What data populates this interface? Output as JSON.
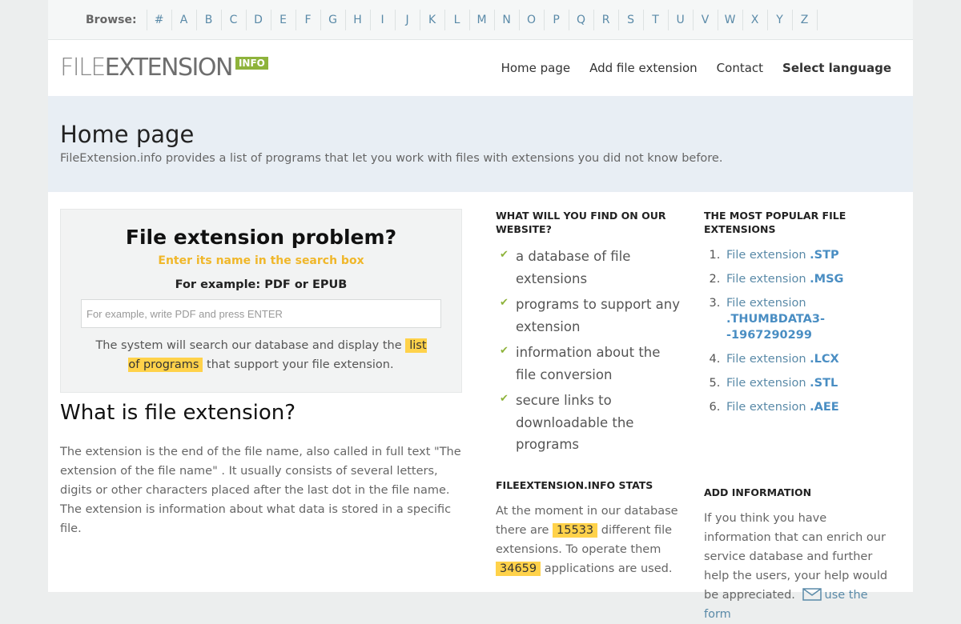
{
  "browse": {
    "label": "Browse:",
    "letters": [
      "#",
      "A",
      "B",
      "C",
      "D",
      "E",
      "F",
      "G",
      "H",
      "I",
      "J",
      "K",
      "L",
      "M",
      "N",
      "O",
      "P",
      "Q",
      "R",
      "S",
      "T",
      "U",
      "V",
      "W",
      "X",
      "Y",
      "Z"
    ]
  },
  "logo": {
    "part1": "FILE",
    "part2": "EXTENSION",
    "tag": "INFO"
  },
  "nav": {
    "home": "Home page",
    "add": "Add file extension",
    "contact": "Contact",
    "language": "Select language"
  },
  "hero": {
    "title": "Home page",
    "subtitle": "FileExtension.info provides a list of programs that let you work with files with extensions you did not know before."
  },
  "search": {
    "title": "File extension problem?",
    "subtitle": "Enter its name in the search box",
    "example": "For example: PDF or EPUB",
    "placeholder": "For example, write PDF and press ENTER",
    "desc_before": "The system will search our database and display the ",
    "desc_highlight": "list of programs",
    "desc_after": " that support your file extension."
  },
  "what": {
    "title": "What is file extension?",
    "text": "The extension is the end of the file name, also called in full text \"The extension of the file name\" . It usually consists of several letters, digits or other characters placed after the last dot in the file name. The extension is information about what data is stored in a specific file."
  },
  "find": {
    "title": "WHAT WILL YOU FIND ON OUR WEBSITE?",
    "items": [
      "a database of file extensions",
      "programs to support any extension",
      "information about the file conversion",
      "secure links to downloadable the programs"
    ]
  },
  "popular": {
    "title": "THE MOST POPULAR FILE EXTENSIONS",
    "prefix": "File extension ",
    "items": [
      ".STP",
      ".MSG",
      ".THUMBDATA3--1967290299",
      ".LCX",
      ".STL",
      ".AEE"
    ]
  },
  "stats": {
    "title": "FILEEXTENSION.INFO STATS",
    "t1": "At the moment in our database there are ",
    "count1": "15533",
    "t2": " different file extensions. To operate them ",
    "count2": "34659",
    "t3": " applications are used."
  },
  "addinfo": {
    "title": "ADD INFORMATION",
    "text": "If you think you have information that can enrich our service database and further help the users, your help would be appreciated.",
    "link": "use the form"
  },
  "colors": {
    "accent_green": "#8eb33b",
    "link_blue": "#5a8aa8",
    "highlight": "#ffd24a",
    "hero_bg": "#e8eef4"
  }
}
